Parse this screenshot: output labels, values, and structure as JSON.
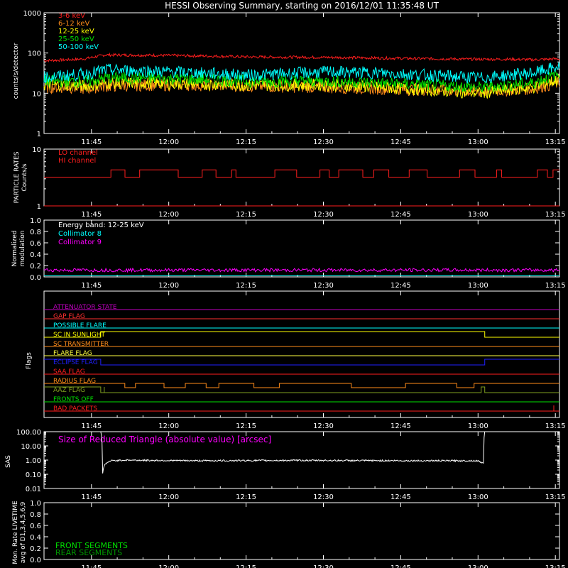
{
  "title": "HESSI Observing Summary, starting on 2016/12/01 11:35:48 UT",
  "time_ticks": [
    "11:45",
    "12:00",
    "12:15",
    "12:30",
    "12:45",
    "13:00",
    "13:15"
  ],
  "time_tick_minutes": [
    9.2,
    24.2,
    39.2,
    54.2,
    69.2,
    84.2,
    99.2
  ],
  "duration_minutes": 100,
  "colors": {
    "3-6 keV": "#ff1e1e",
    "6-12 keV": "#ff8c1a",
    "12-25 keV": "#ffff00",
    "25-50 keV": "#00e000",
    "50-100 keV": "#00ffff",
    "magenta": "#ff00ff",
    "white": "#ffffff"
  },
  "chart_data": [
    {
      "id": "rates",
      "type": "line",
      "ylabel": "counts/s/detector",
      "yscale": "log",
      "ylim": [
        1,
        1000
      ],
      "ytick_labels": [
        "1",
        "10",
        "100",
        "1000"
      ],
      "ytick_values": [
        1,
        10,
        100,
        1000
      ],
      "series": [
        {
          "name": "3-6 keV",
          "color": "#ff1e1e",
          "x": [
            0,
            5,
            8,
            12,
            20,
            30,
            40,
            55,
            65,
            75,
            85,
            90,
            95,
            100
          ],
          "values": [
            65,
            68,
            72,
            90,
            88,
            85,
            80,
            78,
            75,
            72,
            70,
            70,
            68,
            72
          ]
        },
        {
          "name": "6-12 keV",
          "color": "#ff8c1a",
          "x": [
            0,
            5,
            8,
            12,
            20,
            30,
            40,
            55,
            65,
            75,
            85,
            90,
            95,
            100
          ],
          "values": [
            14,
            14,
            13,
            15,
            16,
            16,
            15,
            14,
            13,
            12,
            11,
            12,
            13,
            18
          ]
        },
        {
          "name": "12-25 keV",
          "color": "#ffff00",
          "x": [
            0,
            5,
            8,
            12,
            20,
            30,
            40,
            55,
            65,
            75,
            85,
            90,
            95,
            100
          ],
          "values": [
            16,
            16,
            15,
            18,
            18,
            17,
            16,
            16,
            14,
            12,
            10,
            12,
            14,
            22
          ]
        },
        {
          "name": "25-50 keV",
          "color": "#00e000",
          "x": [
            0,
            5,
            8,
            12,
            20,
            30,
            40,
            55,
            65,
            75,
            85,
            90,
            95,
            100
          ],
          "values": [
            20,
            20,
            19,
            24,
            24,
            22,
            20,
            20,
            18,
            16,
            14,
            16,
            18,
            30
          ]
        },
        {
          "name": "50-100 keV",
          "color": "#00ffff",
          "x": [
            0,
            5,
            8,
            12,
            20,
            30,
            40,
            55,
            65,
            75,
            85,
            90,
            95,
            100
          ],
          "values": [
            25,
            28,
            30,
            38,
            36,
            32,
            28,
            34,
            32,
            28,
            24,
            28,
            32,
            45
          ]
        }
      ]
    },
    {
      "id": "particle",
      "type": "line",
      "ylabel": [
        "PARTICLE RATES",
        "Counts/s"
      ],
      "yscale": "log",
      "ylim": [
        1,
        10
      ],
      "ytick_labels": [
        "1",
        "10"
      ],
      "ytick_values": [
        1,
        10
      ],
      "legend": [
        "LO channel",
        "HI channel"
      ],
      "series": [
        {
          "name": "LO channel",
          "color": "#ff1e1e",
          "low": 3.2,
          "high": 4.3
        },
        {
          "name": "HI channel",
          "color": "#ff1e1e",
          "values": [
            1
          ]
        }
      ]
    },
    {
      "id": "modulation",
      "type": "line",
      "ylabel": [
        "Normalized",
        "modulation"
      ],
      "ylim": [
        0,
        1
      ],
      "ytick_labels": [
        "0.0",
        "0.2",
        "0.4",
        "0.6",
        "0.8",
        "1.0"
      ],
      "ytick_values": [
        0,
        0.2,
        0.4,
        0.6,
        0.8,
        1.0
      ],
      "annotation": "Energy band: 12-25 keV",
      "series": [
        {
          "name": "Collimator 8",
          "color": "#00ffff",
          "values": [
            0.02
          ]
        },
        {
          "name": "Collimator 9",
          "color": "#ff00ff",
          "values": [
            0.12
          ]
        }
      ]
    },
    {
      "id": "flags",
      "type": "line",
      "ylabel": "Flags",
      "flags": [
        {
          "name": "ATTENUATOR STATE",
          "color": "#c000c0"
        },
        {
          "name": "GAP FLAG",
          "color": "#ff3030"
        },
        {
          "name": "POSSIBLE FLARE",
          "color": "#00ffff"
        },
        {
          "name": "SC IN SUNLIGHT",
          "color": "#ffff00"
        },
        {
          "name": "SC TRANSMITTER",
          "color": "#ff8c1a"
        },
        {
          "name": "FLARE FLAG",
          "color": "#ffff40"
        },
        {
          "name": "ECLIPSE FLAG",
          "color": "#2020ff"
        },
        {
          "name": "SAA FLAG",
          "color": "#ff1e1e"
        },
        {
          "name": "RADIUS FLAG",
          "color": "#ff8c1a"
        },
        {
          "name": "AAZ FLAG",
          "color": "#80a020"
        },
        {
          "name": "FRONTS OFF",
          "color": "#00e000"
        },
        {
          "name": "BAD PACKETS",
          "color": "#ff1e1e"
        }
      ],
      "sunlight_interval": [
        11.0,
        85.5
      ],
      "eclipse_interval": [
        11.0,
        85.5
      ]
    },
    {
      "id": "sas",
      "type": "line",
      "ylabel": "SAS",
      "yscale": "log",
      "ylim": [
        0.01,
        100
      ],
      "ytick_labels": [
        "0.01",
        "0.10",
        "1.00",
        "10.00",
        "100.00"
      ],
      "ytick_values": [
        0.01,
        0.1,
        1,
        10,
        100
      ],
      "annotation": "Size of Reduced Triangle (absolute value) [arcsec]",
      "series": [
        {
          "name": "SAS",
          "color": "#ffffff",
          "x": [
            11.0,
            11.3,
            11.8,
            13,
            16,
            20,
            30,
            50,
            70,
            84,
            85.3,
            85.5
          ],
          "values": [
            100,
            0.05,
            0.5,
            0.9,
            1.0,
            0.95,
            0.9,
            0.95,
            0.9,
            0.9,
            0.6,
            100
          ]
        }
      ]
    },
    {
      "id": "livetime",
      "type": "line",
      "ylabel": [
        "Mon. Rate LIVETIME",
        "avg of D1,3,4,5,6,9"
      ],
      "ylim": [
        0,
        1
      ],
      "ytick_labels": [
        "0.0",
        "0.2",
        "0.4",
        "0.6",
        "0.8",
        "1.0"
      ],
      "ytick_values": [
        0,
        0.2,
        0.4,
        0.6,
        0.8,
        1.0
      ],
      "legend": [
        "FRONT SEGMENTS",
        "REAR SEGMENTS"
      ],
      "series": []
    }
  ]
}
